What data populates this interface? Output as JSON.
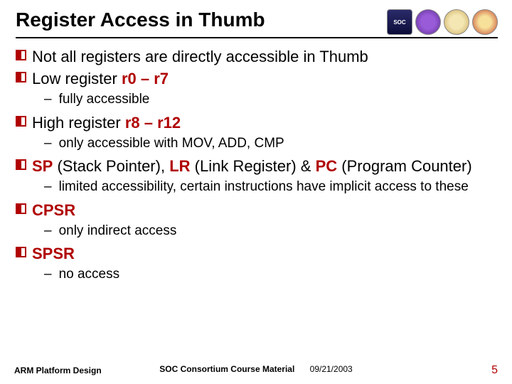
{
  "title": "Register Access in Thumb",
  "logos": {
    "soc_text": "SOC"
  },
  "bullets": {
    "b1": "Not all registers are directly accessible in Thumb",
    "b2a": "Low register ",
    "b2b": "r0 – r7",
    "b2_sub": "fully accessible",
    "b3a": "High register ",
    "b3b": "r8 – r12",
    "b3_sub": "only accessible with MOV, ADD, CMP",
    "b4_sp": "SP",
    "b4_sp_p": " (Stack Pointer), ",
    "b4_lr": "LR",
    "b4_lr_p": " (Link Register) & ",
    "b4_pc": "PC",
    "b4_pc_p": " (Program Counter)",
    "b4_sub": "limited accessibility, certain instructions have implicit access to these",
    "b5": "CPSR",
    "b5_sub": "only indirect access",
    "b6": "SPSR",
    "b6_sub": "no access"
  },
  "footer": {
    "left": "ARM Platform Design",
    "center": "SOC Consortium Course Material",
    "date": "09/21/2003",
    "page": "5"
  }
}
